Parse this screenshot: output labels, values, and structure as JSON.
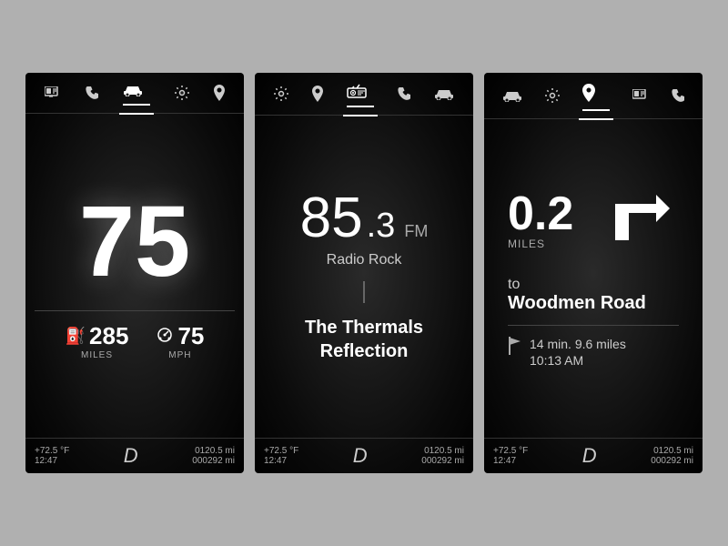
{
  "panels": [
    {
      "id": "speed-panel",
      "nav_icons": [
        {
          "name": "media-icon",
          "symbol": "⊟",
          "active": false
        },
        {
          "name": "phone-icon",
          "symbol": "✆",
          "active": false
        },
        {
          "name": "car-icon",
          "symbol": "🚗",
          "active": true
        },
        {
          "name": "settings-icon",
          "symbol": "⚙",
          "active": false
        },
        {
          "name": "location-icon",
          "symbol": "📍",
          "active": false
        }
      ],
      "speed": "75",
      "fuel_miles": "285",
      "fuel_label": "MILES",
      "current_speed": "75",
      "speed_label": "MPH",
      "footer": {
        "temp": "+72.5 °F",
        "time": "12:47",
        "gear": "D",
        "trip1": "0120.5 mi",
        "trip2": "000292 mi"
      }
    },
    {
      "id": "radio-panel",
      "nav_icons": [
        {
          "name": "settings-icon",
          "symbol": "⚙",
          "active": false
        },
        {
          "name": "location-icon",
          "symbol": "📍",
          "active": false
        },
        {
          "name": "radio-icon",
          "symbol": "📻",
          "active": true
        },
        {
          "name": "phone-icon",
          "symbol": "✆",
          "active": false
        },
        {
          "name": "car-icon",
          "symbol": "🚗",
          "active": false
        }
      ],
      "frequency": "85",
      "frequency_decimal": ".3",
      "band": "FM",
      "station_name": "Radio Rock",
      "song_title": "The Thermals",
      "song_subtitle": "Reflection",
      "footer": {
        "temp": "+72.5 °F",
        "time": "12:47",
        "gear": "D",
        "trip1": "0120.5 mi",
        "trip2": "000292 mi"
      }
    },
    {
      "id": "nav-panel",
      "nav_icons": [
        {
          "name": "car-icon",
          "symbol": "🚗",
          "active": false
        },
        {
          "name": "settings-icon",
          "symbol": "⚙",
          "active": false
        },
        {
          "name": "location-icon",
          "symbol": "📍",
          "active": true
        },
        {
          "name": "media-icon",
          "symbol": "⊟",
          "active": false
        },
        {
          "name": "phone-icon",
          "symbol": "✆",
          "active": false
        }
      ],
      "distance": "0.2",
      "distance_label": "MILES",
      "road_prefix": "to",
      "road_name": "Woodmen Road",
      "eta_time": "14 min.",
      "eta_distance": "9.6 miles",
      "eta_arrival": "10:13 AM",
      "footer": {
        "temp": "+72.5 °F",
        "time": "12:47",
        "gear": "D",
        "trip1": "0120.5 mi",
        "trip2": "000292 mi"
      }
    }
  ]
}
